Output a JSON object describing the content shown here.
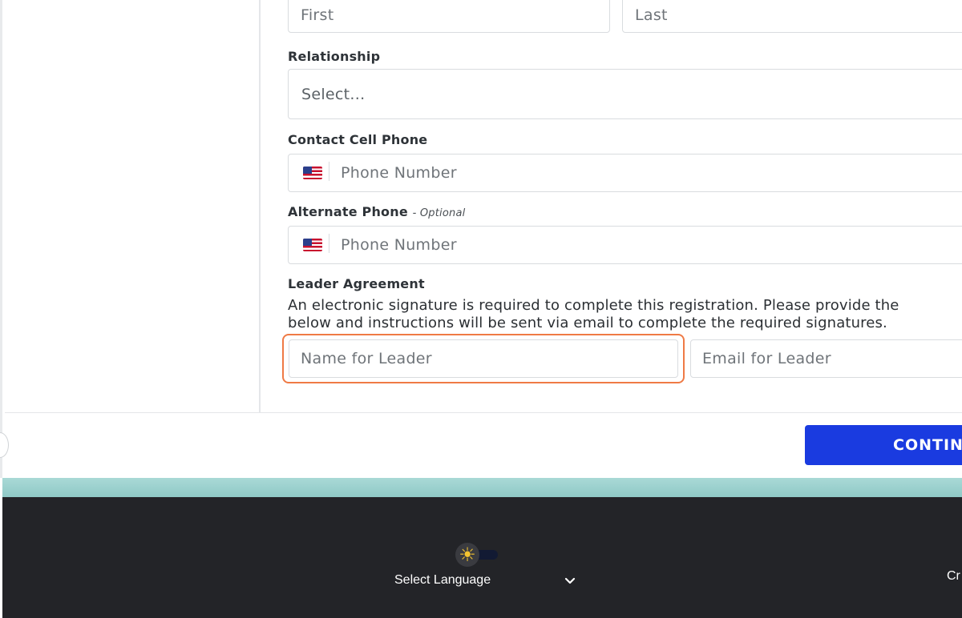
{
  "contact_name": {
    "first_placeholder": "First",
    "last_placeholder": "Last"
  },
  "relationship": {
    "label": "Relationship",
    "placeholder": "Select..."
  },
  "contact_cell_phone": {
    "label": "Contact Cell Phone",
    "placeholder": "Phone Number",
    "flag_icon": "us-flag-icon"
  },
  "alternate_phone": {
    "label": "Alternate Phone",
    "optional_note": "- Optional",
    "placeholder": "Phone Number",
    "flag_icon": "us-flag-icon"
  },
  "leader_agreement": {
    "label": "Leader Agreement",
    "description_line1": "An electronic signature is required to complete this registration. Please provide the",
    "description_line2": "below and instructions will be sent via email to complete the required signatures.",
    "name_placeholder": "Name for Leader",
    "email_placeholder": "Email for Leader"
  },
  "actions": {
    "continue_label": "CONTINUE"
  },
  "footer": {
    "theme_toggle_icon": "sun-icon",
    "language_label": "Select Language",
    "language_chevron_icon": "chevron-down-icon",
    "edge_text": "Cr"
  },
  "colors": {
    "accent_blue": "#1a3be0",
    "highlight_orange": "#ef7a45",
    "footer_bg": "#232428",
    "teal_band": "#a9d9d6",
    "sun_yellow": "#f4c430"
  }
}
